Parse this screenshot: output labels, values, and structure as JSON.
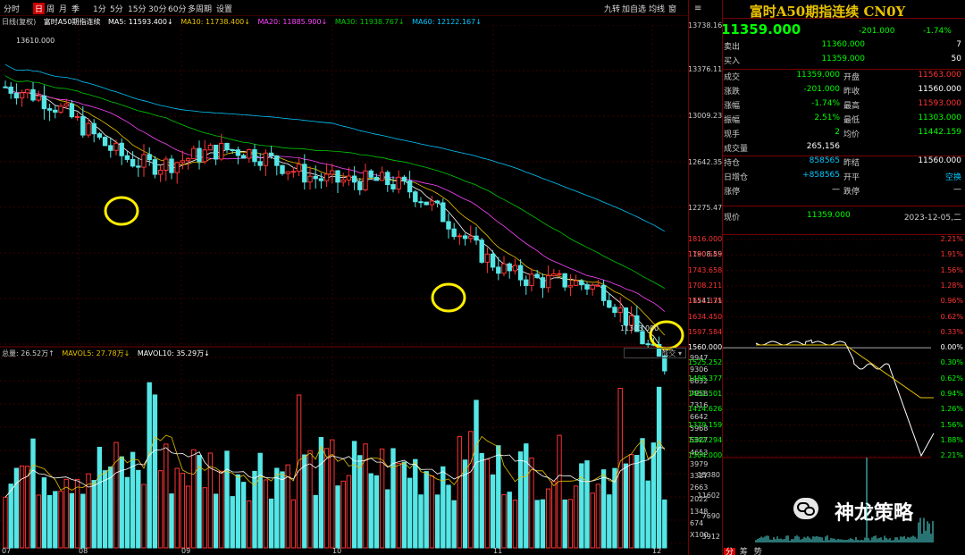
{
  "toolbar": {
    "left_items": [
      "分时",
      "日",
      "周",
      "月",
      "季",
      "1分",
      "5分",
      "15分",
      "30分",
      "60分",
      "多周期",
      "设置"
    ],
    "active_item": "日",
    "right_items": [
      "九转",
      "加自选",
      "均线",
      "窗"
    ]
  },
  "main_legend": {
    "name": "日线(复权)",
    "symbol": "富时A50期指连续",
    "ma5": "MA5: 11593.400↓",
    "ma10": "MA10: 11738.400↓",
    "ma20": "MA20: 11885.900↓",
    "ma30": "MA30: 11938.767↓",
    "ma60": "MA60: 12122.167↓",
    "colors": {
      "ma5": "#ffffff",
      "ma10": "#e8c200",
      "ma20": "#ff44ff",
      "ma30": "#00cc00",
      "ma60": "#00c8ff"
    }
  },
  "price_axis": [
    "13738.16",
    "13376.11",
    "13009.23",
    "12642.35",
    "12275.47",
    "11908.59",
    "11541.71"
  ],
  "price_axis_bottom_box": "成交",
  "high_label": "13610.000",
  "low_label": "11303.000",
  "vol_legend": {
    "total": "总量: 26.52万↑",
    "mavol5": "MAVOL5: 27.78万↓",
    "mavol10": "MAVOL10: 35.29万↓"
  },
  "vol_axis": [
    "9947",
    "9306",
    "8632",
    "7958",
    "7316",
    "6642",
    "5968",
    "5327",
    "4653",
    "3979",
    "3337",
    "2663",
    "2022",
    "1348",
    "674",
    "X100"
  ],
  "date_axis": [
    "07",
    "08",
    "09",
    "10",
    "11",
    "12"
  ],
  "watermark": "神龙策略",
  "quote": {
    "title": "富时A50期指连续 CN0Y",
    "last": "11359.000",
    "change": "-201.000",
    "change_pct": "-1.74%",
    "sell_label": "卖出",
    "sell_price": "11360.000",
    "sell_vol": "7",
    "buy_label": "买入",
    "buy_price": "11359.000",
    "buy_vol": "50",
    "rows": [
      {
        "l1": "成交",
        "v1": "11359.000",
        "l2": "开盘",
        "v2": "11563.000",
        "c1": "#00ff00",
        "c2": "#ff3333"
      },
      {
        "l1": "涨跌",
        "v1": "-201.000",
        "l2": "昨收",
        "v2": "11560.000",
        "c1": "#00ff00",
        "c2": "#ffffff"
      },
      {
        "l1": "涨幅",
        "v1": "-1.74%",
        "l2": "最高",
        "v2": "11593.000",
        "c1": "#00ff00",
        "c2": "#ff3333"
      },
      {
        "l1": "振幅",
        "v1": "2.51%",
        "l2": "最低",
        "v2": "11303.000",
        "c1": "#00ff00",
        "c2": "#00ff00"
      },
      {
        "l1": "现手",
        "v1": "2",
        "l2": "均价",
        "v2": "11442.159",
        "c1": "#00ff00",
        "c2": "#00ff00"
      },
      {
        "l1": "成交量",
        "v1": "265,156",
        "l2": "",
        "v2": "",
        "c1": "#ffffff",
        "c2": "#ffffff"
      }
    ],
    "rows2": [
      {
        "l1": "持仓",
        "v1": "858565",
        "l2": "昨结",
        "v2": "11560.000",
        "c1": "#00c8ff",
        "c2": "#ffffff"
      },
      {
        "l1": "日增仓",
        "v1": "+858565",
        "l2": "开平",
        "v2": "空换",
        "c1": "#00c8ff",
        "c2": "#00c8ff"
      },
      {
        "l1": "涨停",
        "v1": "—",
        "l2": "跌停",
        "v2": "—",
        "c1": "#ffffff",
        "c2": "#ffffff"
      }
    ],
    "price_now_label": "现价",
    "price_now_value": "11359.000",
    "datetime": "2023-12-05,二"
  },
  "mini_chart": {
    "left_axis": [
      "1816.000",
      "1780.543",
      "1743.658",
      "1708.211",
      "1671.335",
      "1634.450",
      "1597.584",
      "1560.000",
      "1525.252",
      "1488.377",
      "1451.501",
      "1414.626",
      "1379.159",
      "1342.294",
      "1304.000"
    ],
    "right_axis": [
      "2.21%",
      "1.91%",
      "1.56%",
      "1.28%",
      "0.96%",
      "0.62%",
      "0.33%",
      "0.00%",
      "0.30%",
      "0.62%",
      "0.94%",
      "1.26%",
      "1.56%",
      "1.88%",
      "2.21%"
    ],
    "vol_axis": [
      "15380",
      "11602",
      "7690",
      "3912"
    ],
    "bottom_tabs": [
      "分",
      "筹",
      "势"
    ]
  }
}
